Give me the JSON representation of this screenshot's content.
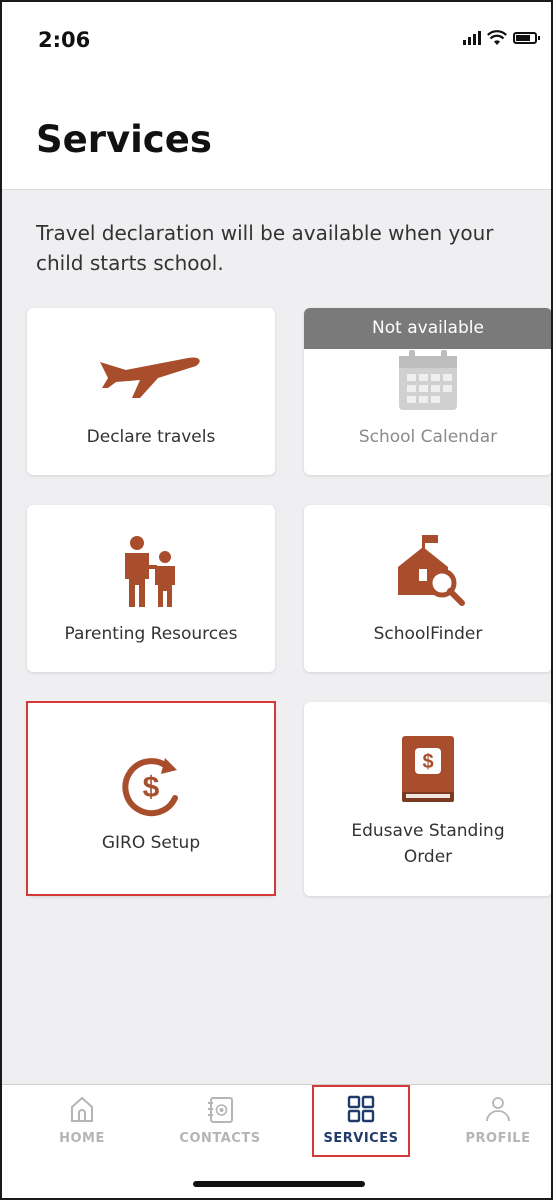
{
  "status_bar": {
    "time": "2:06"
  },
  "header": {
    "title": "Services"
  },
  "notice": "Travel declaration will be available when your child starts school.",
  "tiles": [
    {
      "label": "Declare travels",
      "icon": "airplane-icon",
      "available": true
    },
    {
      "label": "School Calendar",
      "icon": "calendar-icon",
      "available": false,
      "banner": "Not available"
    },
    {
      "label": "Parenting Resources",
      "icon": "parent-child-icon",
      "available": true
    },
    {
      "label": "SchoolFinder",
      "icon": "school-search-icon",
      "available": true
    },
    {
      "label": "GIRO Setup",
      "icon": "dollar-cycle-icon",
      "available": true
    },
    {
      "label": "Edusave Standing Order",
      "label_line1": "Edusave Standing",
      "label_line2": "Order",
      "icon": "dollar-book-icon",
      "available": true
    }
  ],
  "tabbar": {
    "items": [
      {
        "label": "HOME",
        "icon": "home-icon",
        "active": false
      },
      {
        "label": "CONTACTS",
        "icon": "contacts-icon",
        "active": false
      },
      {
        "label": "SERVICES",
        "icon": "grid-icon",
        "active": true
      },
      {
        "label": "PROFILE",
        "icon": "profile-icon",
        "active": false
      }
    ]
  },
  "colors": {
    "accent_icon": "#a84e2c",
    "active_tab": "#1f3a6b",
    "highlight_box": "#d23a3a",
    "disabled_banner": "#7a7a7a"
  }
}
